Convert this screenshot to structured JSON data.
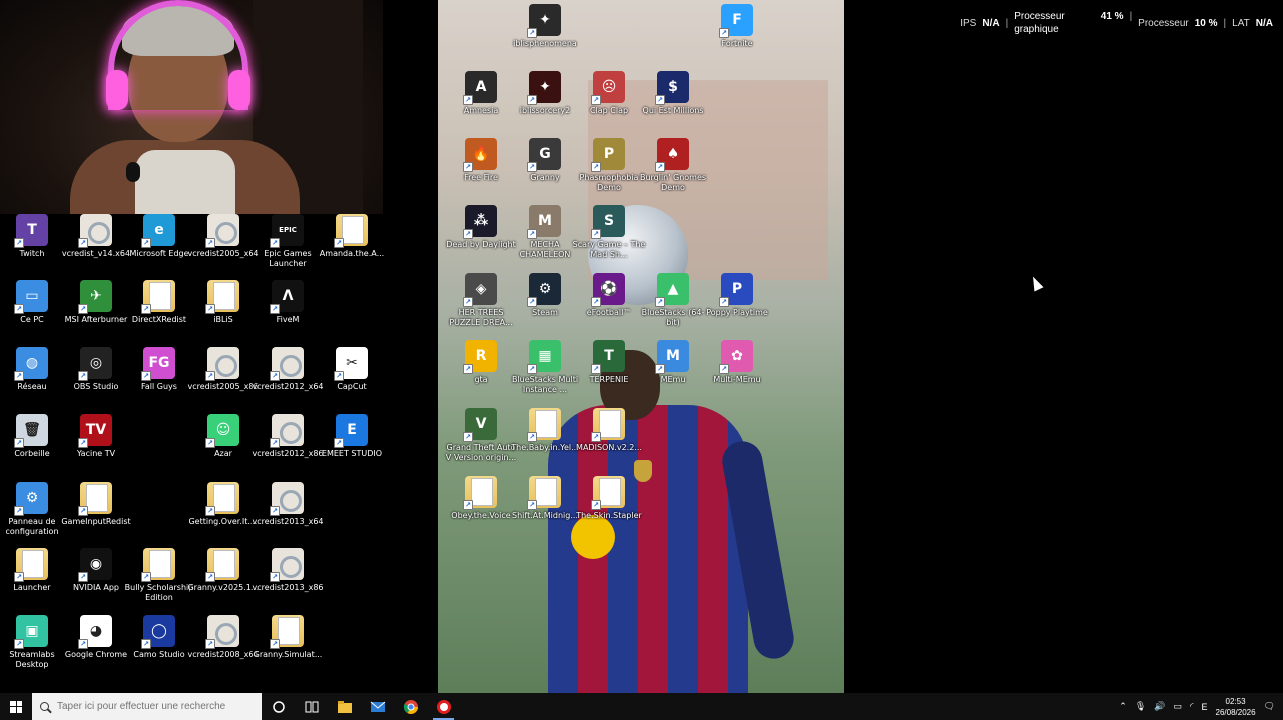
{
  "stats": {
    "ips_label": "IPS",
    "ips_value": "N/A",
    "gpu_label_1": "Processeur",
    "gpu_label_2": "graphique",
    "gpu_value": "41 %",
    "cpu_label": "Processeur",
    "cpu_value": "10 %",
    "lat_label": "LAT",
    "lat_value": "N/A"
  },
  "left_icons": [
    {
      "label": "Twitch",
      "icon": "twitch-icon",
      "color": "#6441a5"
    },
    {
      "label": "vcredist_v14.x64",
      "icon": "setup-icon",
      "color": "#e8e4dc"
    },
    {
      "label": "Microsoft Edge",
      "icon": "edge-icon",
      "color": "#1f9ad6"
    },
    {
      "label": "vcredist2005_x64",
      "icon": "setup-icon",
      "color": "#e8e4dc"
    },
    {
      "label": "Epic Games Launcher",
      "icon": "epic-icon",
      "color": "#111111"
    },
    {
      "label": "Amanda.the.A...",
      "icon": "folder-icon",
      "color": "#e8c05c"
    },
    {
      "label": "Ce PC",
      "icon": "computer-icon",
      "color": "#3a8de0"
    },
    {
      "label": "MSI Afterburner",
      "icon": "afterburner-icon",
      "color": "#2f8f3a"
    },
    {
      "label": "DirectXRedist",
      "icon": "folder-icon",
      "color": "#e8c05c"
    },
    {
      "label": "iBLiS",
      "icon": "folder-icon",
      "color": "#e8c05c"
    },
    {
      "label": "FiveM",
      "icon": "fivem-icon",
      "color": "#111111"
    },
    {
      "label": "Réseau",
      "icon": "network-icon",
      "color": "#3a8de0"
    },
    {
      "label": "OBS Studio",
      "icon": "obs-icon",
      "color": "#222222"
    },
    {
      "label": "Fall Guys",
      "icon": "fallguys-icon",
      "color": "#d04fd0"
    },
    {
      "label": "vcredist2005_x86",
      "icon": "setup-icon",
      "color": "#e8e4dc"
    },
    {
      "label": "vcredist2012_x64",
      "icon": "setup-icon",
      "color": "#e8e4dc"
    },
    {
      "label": "CapCut",
      "icon": "capcut-icon",
      "color": "#ffffff"
    },
    {
      "label": "Corbeille",
      "icon": "recycle-bin-icon",
      "color": "#cfd8e0"
    },
    {
      "label": "Yacine TV",
      "icon": "yacine-icon",
      "color": "#b0101a"
    },
    {
      "label": "Azar",
      "icon": "azar-icon",
      "color": "#39d07a"
    },
    {
      "label": "vcredist2012_x86",
      "icon": "setup-icon",
      "color": "#e8e4dc"
    },
    {
      "label": "EMEET STUDIO",
      "icon": "emeet-icon",
      "color": "#1a78e0"
    },
    {
      "label": "Panneau de configuration",
      "icon": "control-panel-icon",
      "color": "#3a8de0"
    },
    {
      "label": "GameInputRedist",
      "icon": "folder-icon",
      "color": "#e8c05c"
    },
    {
      "label": "Getting.Over.It....",
      "icon": "folder-icon",
      "color": "#e8c05c"
    },
    {
      "label": "vcredist2013_x64",
      "icon": "setup-icon",
      "color": "#e8e4dc"
    },
    {
      "label": "Launcher",
      "icon": "folder-icon",
      "color": "#e8c05c"
    },
    {
      "label": "NVIDIA App",
      "icon": "nvidia-icon",
      "color": "#111111"
    },
    {
      "label": "Bully Scholarship Edition",
      "icon": "folder-icon",
      "color": "#e8c05c"
    },
    {
      "label": "Granny.v2025.1...",
      "icon": "folder-icon",
      "color": "#e8c05c"
    },
    {
      "label": "vcredist2013_x86",
      "icon": "setup-icon",
      "color": "#e8e4dc"
    },
    {
      "label": "Streamlabs Desktop",
      "icon": "streamlabs-icon",
      "color": "#31c3a2"
    },
    {
      "label": "Google Chrome",
      "icon": "chrome-icon",
      "color": "#ffffff"
    },
    {
      "label": "Camo Studio",
      "icon": "camo-icon",
      "color": "#1a3aa0"
    },
    {
      "label": "vcredist2008_x64",
      "icon": "setup-icon",
      "color": "#e8e4dc"
    },
    {
      "label": "Granny.Simulat...",
      "icon": "folder-icon",
      "color": "#e8c05c"
    }
  ],
  "right_icons": [
    {
      "label": "iblisphenomena",
      "icon": "iblis-game-icon",
      "color": "#2a2a2a"
    },
    {
      "label": "Fortnite",
      "icon": "fortnite-icon",
      "color": "#2aa0ff"
    },
    {
      "label": "Amnesia",
      "icon": "amnesia-icon",
      "color": "#2a2a2a"
    },
    {
      "label": "iblissorcery2",
      "icon": "iblis-game-icon",
      "color": "#3a1010"
    },
    {
      "label": "Clap Clap",
      "icon": "clapclap-icon",
      "color": "#c04040"
    },
    {
      "label": "Qui Est Millions",
      "icon": "millions-icon",
      "color": "#1a2a6a"
    },
    {
      "label": "Free Fire",
      "icon": "freefire-icon",
      "color": "#c05a20"
    },
    {
      "label": "Granny",
      "icon": "granny-icon",
      "color": "#3a3a3a"
    },
    {
      "label": "Phasmophobia Demo",
      "icon": "phasmo-icon",
      "color": "#a08a3a"
    },
    {
      "label": "Burglin' Gnomes Demo",
      "icon": "gnomes-icon",
      "color": "#b02020"
    },
    {
      "label": "Dead by Daylight",
      "icon": "dbd-icon",
      "color": "#1a1a2a"
    },
    {
      "label": "MECHA CHAMELEON",
      "icon": "mecha-icon",
      "color": "#8a7a6a"
    },
    {
      "label": "Scary Game – The Mad Sh...",
      "icon": "scary-game-icon",
      "color": "#2a5a5a"
    },
    {
      "label": "HER TREES PUZZLE DREA...",
      "icon": "puzzle-icon",
      "color": "#4a4a4a"
    },
    {
      "label": "Steam",
      "icon": "steam-icon",
      "color": "#1b2838"
    },
    {
      "label": "eFootball™",
      "icon": "efootball-icon",
      "color": "#6a1a8a"
    },
    {
      "label": "BlueStacks (64-bit)",
      "icon": "bluestacks-icon",
      "color": "#3ac06a"
    },
    {
      "label": "Poppy Playtime",
      "icon": "poppy-icon",
      "color": "#2a4ac0"
    },
    {
      "label": "gta",
      "icon": "rockstar-icon",
      "color": "#f2b200"
    },
    {
      "label": "BlueStacks Multi Instance ...",
      "icon": "bluestacks-multi-icon",
      "color": "#3ac06a"
    },
    {
      "label": "TERPENIE",
      "icon": "terpenie-icon",
      "color": "#2a6a3a"
    },
    {
      "label": "MEmu",
      "icon": "memu-icon",
      "color": "#3a8ae0"
    },
    {
      "label": "Multi-MEmu",
      "icon": "multi-memu-icon",
      "color": "#e05ab0"
    },
    {
      "label": "Grand Theft Auto V Version origin...",
      "icon": "gtav-icon",
      "color": "#3a6a3a"
    },
    {
      "label": "The.Baby.in.Yel...",
      "icon": "folder-icon",
      "color": "#e8c05c"
    },
    {
      "label": "MADISON.v2.2...",
      "icon": "folder-icon",
      "color": "#e8c05c"
    },
    {
      "label": "Obey.the.Voice",
      "icon": "folder-icon",
      "color": "#e8c05c"
    },
    {
      "label": "Shift.At.Midnig...",
      "icon": "folder-icon",
      "color": "#e8c05c"
    },
    {
      "label": "The.Skin.Stapler",
      "icon": "folder-icon",
      "color": "#e8c05c"
    }
  ],
  "taskbar": {
    "search_placeholder": "Taper ici pour effectuer une recherche",
    "time": "02:53",
    "date": "26/08/2026",
    "lang": "E"
  }
}
